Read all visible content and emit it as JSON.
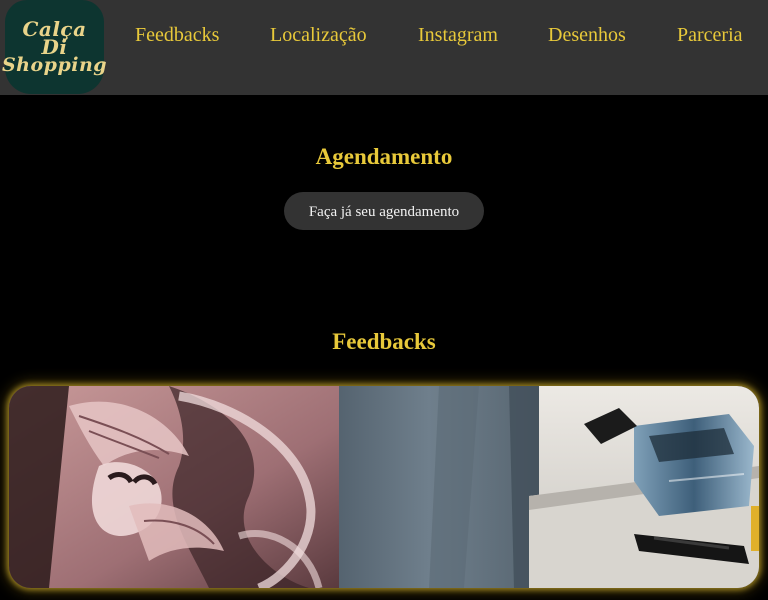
{
  "header": {
    "logo": {
      "line1": "Calça",
      "line2": "Di",
      "line3": "Shopping"
    },
    "nav": [
      {
        "label": "Feedbacks"
      },
      {
        "label": "Localização"
      },
      {
        "label": "Instagram"
      },
      {
        "label": "Desenhos"
      },
      {
        "label": "Parceria"
      }
    ]
  },
  "agendamento": {
    "title": "Agendamento",
    "button_label": "Faça já seu agendamento"
  },
  "feedbacks": {
    "title": "Feedbacks",
    "image_icon": "tattoo-photo"
  },
  "colors": {
    "accent": "#e8c93a",
    "navbar": "#333333",
    "logo_bg": "#0d3530",
    "page_bg": "#000000"
  }
}
